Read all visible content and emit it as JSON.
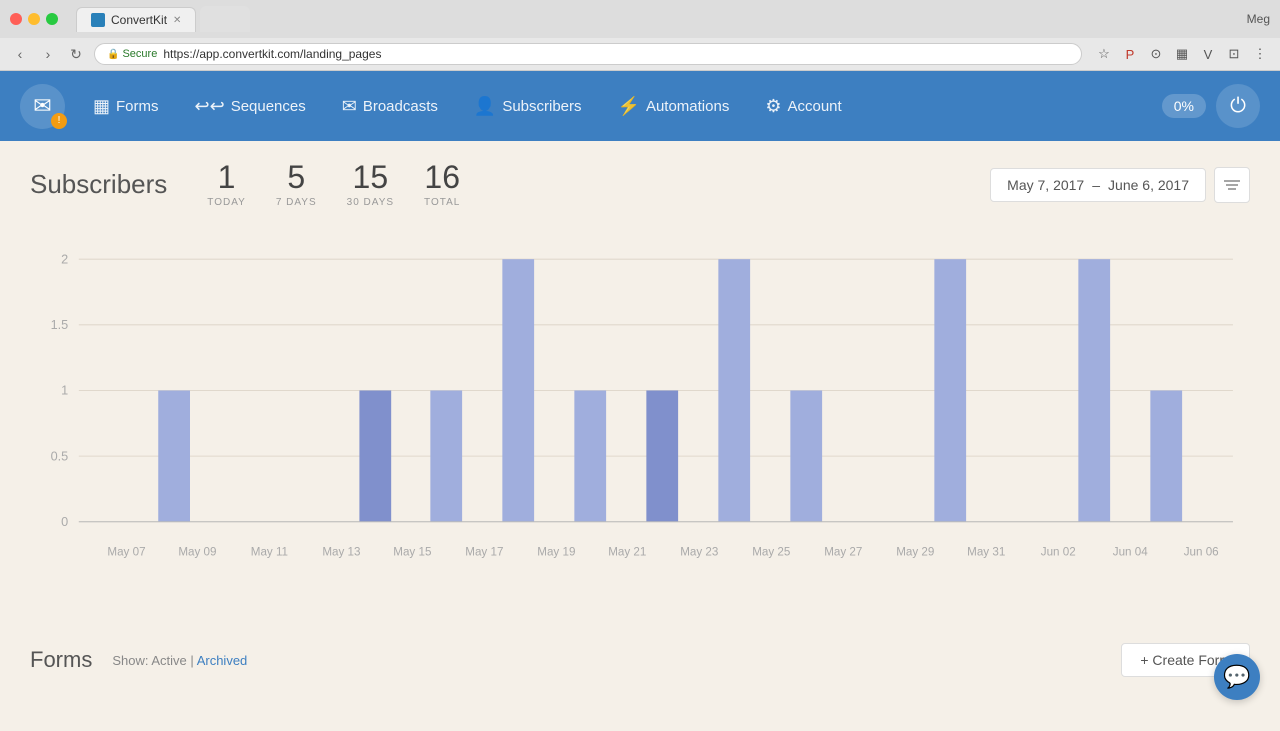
{
  "browser": {
    "tab_title": "ConvertKit",
    "tab_favicon": "ck",
    "url_protocol": "Secure",
    "url": "https://app.convertkit.com/landing_pages",
    "user": "Meg"
  },
  "nav": {
    "logo_icon": "✉",
    "warning_icon": "!",
    "items": [
      {
        "id": "forms",
        "label": "Forms",
        "icon": "▦"
      },
      {
        "id": "sequences",
        "label": "Sequences",
        "icon": "↩↩"
      },
      {
        "id": "broadcasts",
        "label": "Broadcasts",
        "icon": "✉"
      },
      {
        "id": "subscribers",
        "label": "Subscribers",
        "icon": "👤"
      },
      {
        "id": "automations",
        "label": "Automations",
        "icon": "⚡"
      },
      {
        "id": "account",
        "label": "Account",
        "icon": "⚙"
      }
    ],
    "pct_label": "0%",
    "power_icon": "⏻"
  },
  "subscribers": {
    "title": "Subscribers",
    "stats": {
      "today": {
        "value": "1",
        "label": "TODAY"
      },
      "seven_days": {
        "value": "5",
        "label": "7 DAYS"
      },
      "thirty_days": {
        "value": "15",
        "label": "30 DAYS"
      },
      "total": {
        "value": "16",
        "label": "TOTAL"
      }
    },
    "date_range": {
      "start": "May 7, 2017",
      "dash": "–",
      "end": "June 6, 2017"
    }
  },
  "chart": {
    "y_labels": [
      "2",
      "1.5",
      "1",
      "0.5",
      "0"
    ],
    "x_labels": [
      "May 07",
      "May 09",
      "May 11",
      "May 13",
      "May 15",
      "May 17",
      "May 19",
      "May 21",
      "May 23",
      "May 25",
      "May 27",
      "May 29",
      "May 31",
      "Jun 02",
      "Jun 04",
      "Jun 06"
    ],
    "bar_color": "#a0aedd",
    "bar_color_dark": "#8090cc",
    "bars": [
      {
        "date": "May 07",
        "value": 0,
        "dark": false
      },
      {
        "date": "May 09",
        "value": 1,
        "dark": false
      },
      {
        "date": "May 11",
        "value": 0,
        "dark": false
      },
      {
        "date": "May 13",
        "value": 0,
        "dark": false
      },
      {
        "date": "May 15",
        "value": 1,
        "dark": true
      },
      {
        "date": "May 17",
        "value": 1,
        "dark": false
      },
      {
        "date": "May 19",
        "value": 2,
        "dark": false
      },
      {
        "date": "May 21",
        "value": 1,
        "dark": false
      },
      {
        "date": "May 23",
        "value": 1,
        "dark": true
      },
      {
        "date": "May 25",
        "value": 2,
        "dark": false
      },
      {
        "date": "May 27",
        "value": 1,
        "dark": false
      },
      {
        "date": "May 29",
        "value": 0,
        "dark": false
      },
      {
        "date": "May 31",
        "value": 2,
        "dark": false
      },
      {
        "date": "Jun 02",
        "value": 0,
        "dark": false
      },
      {
        "date": "Jun 04",
        "value": 2,
        "dark": false
      },
      {
        "date": "Jun 06",
        "value": 1,
        "dark": false
      }
    ]
  },
  "forms": {
    "title": "Forms",
    "show_label": "Show:",
    "active_label": "Active",
    "pipe": "|",
    "archived_label": "Archived",
    "create_btn": "+ Create Form"
  }
}
